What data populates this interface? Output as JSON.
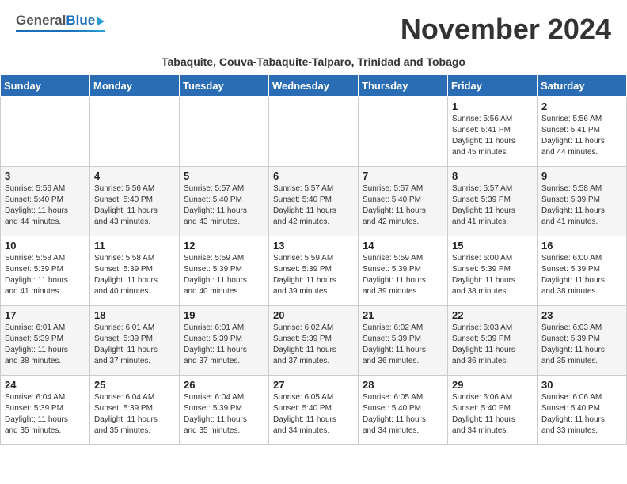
{
  "header": {
    "logo_general": "General",
    "logo_blue": "Blue",
    "month_title": "November 2024",
    "subtitle": "Tabaquite, Couva-Tabaquite-Talparo, Trinidad and Tobago"
  },
  "calendar": {
    "days_of_week": [
      "Sunday",
      "Monday",
      "Tuesday",
      "Wednesday",
      "Thursday",
      "Friday",
      "Saturday"
    ],
    "weeks": [
      [
        {
          "date": "",
          "info": ""
        },
        {
          "date": "",
          "info": ""
        },
        {
          "date": "",
          "info": ""
        },
        {
          "date": "",
          "info": ""
        },
        {
          "date": "",
          "info": ""
        },
        {
          "date": "1",
          "info": "Sunrise: 5:56 AM\nSunset: 5:41 PM\nDaylight: 11 hours\nand 45 minutes."
        },
        {
          "date": "2",
          "info": "Sunrise: 5:56 AM\nSunset: 5:41 PM\nDaylight: 11 hours\nand 44 minutes."
        }
      ],
      [
        {
          "date": "3",
          "info": "Sunrise: 5:56 AM\nSunset: 5:40 PM\nDaylight: 11 hours\nand 44 minutes."
        },
        {
          "date": "4",
          "info": "Sunrise: 5:56 AM\nSunset: 5:40 PM\nDaylight: 11 hours\nand 43 minutes."
        },
        {
          "date": "5",
          "info": "Sunrise: 5:57 AM\nSunset: 5:40 PM\nDaylight: 11 hours\nand 43 minutes."
        },
        {
          "date": "6",
          "info": "Sunrise: 5:57 AM\nSunset: 5:40 PM\nDaylight: 11 hours\nand 42 minutes."
        },
        {
          "date": "7",
          "info": "Sunrise: 5:57 AM\nSunset: 5:40 PM\nDaylight: 11 hours\nand 42 minutes."
        },
        {
          "date": "8",
          "info": "Sunrise: 5:57 AM\nSunset: 5:39 PM\nDaylight: 11 hours\nand 41 minutes."
        },
        {
          "date": "9",
          "info": "Sunrise: 5:58 AM\nSunset: 5:39 PM\nDaylight: 11 hours\nand 41 minutes."
        }
      ],
      [
        {
          "date": "10",
          "info": "Sunrise: 5:58 AM\nSunset: 5:39 PM\nDaylight: 11 hours\nand 41 minutes."
        },
        {
          "date": "11",
          "info": "Sunrise: 5:58 AM\nSunset: 5:39 PM\nDaylight: 11 hours\nand 40 minutes."
        },
        {
          "date": "12",
          "info": "Sunrise: 5:59 AM\nSunset: 5:39 PM\nDaylight: 11 hours\nand 40 minutes."
        },
        {
          "date": "13",
          "info": "Sunrise: 5:59 AM\nSunset: 5:39 PM\nDaylight: 11 hours\nand 39 minutes."
        },
        {
          "date": "14",
          "info": "Sunrise: 5:59 AM\nSunset: 5:39 PM\nDaylight: 11 hours\nand 39 minutes."
        },
        {
          "date": "15",
          "info": "Sunrise: 6:00 AM\nSunset: 5:39 PM\nDaylight: 11 hours\nand 38 minutes."
        },
        {
          "date": "16",
          "info": "Sunrise: 6:00 AM\nSunset: 5:39 PM\nDaylight: 11 hours\nand 38 minutes."
        }
      ],
      [
        {
          "date": "17",
          "info": "Sunrise: 6:01 AM\nSunset: 5:39 PM\nDaylight: 11 hours\nand 38 minutes."
        },
        {
          "date": "18",
          "info": "Sunrise: 6:01 AM\nSunset: 5:39 PM\nDaylight: 11 hours\nand 37 minutes."
        },
        {
          "date": "19",
          "info": "Sunrise: 6:01 AM\nSunset: 5:39 PM\nDaylight: 11 hours\nand 37 minutes."
        },
        {
          "date": "20",
          "info": "Sunrise: 6:02 AM\nSunset: 5:39 PM\nDaylight: 11 hours\nand 37 minutes."
        },
        {
          "date": "21",
          "info": "Sunrise: 6:02 AM\nSunset: 5:39 PM\nDaylight: 11 hours\nand 36 minutes."
        },
        {
          "date": "22",
          "info": "Sunrise: 6:03 AM\nSunset: 5:39 PM\nDaylight: 11 hours\nand 36 minutes."
        },
        {
          "date": "23",
          "info": "Sunrise: 6:03 AM\nSunset: 5:39 PM\nDaylight: 11 hours\nand 35 minutes."
        }
      ],
      [
        {
          "date": "24",
          "info": "Sunrise: 6:04 AM\nSunset: 5:39 PM\nDaylight: 11 hours\nand 35 minutes."
        },
        {
          "date": "25",
          "info": "Sunrise: 6:04 AM\nSunset: 5:39 PM\nDaylight: 11 hours\nand 35 minutes."
        },
        {
          "date": "26",
          "info": "Sunrise: 6:04 AM\nSunset: 5:39 PM\nDaylight: 11 hours\nand 35 minutes."
        },
        {
          "date": "27",
          "info": "Sunrise: 6:05 AM\nSunset: 5:40 PM\nDaylight: 11 hours\nand 34 minutes."
        },
        {
          "date": "28",
          "info": "Sunrise: 6:05 AM\nSunset: 5:40 PM\nDaylight: 11 hours\nand 34 minutes."
        },
        {
          "date": "29",
          "info": "Sunrise: 6:06 AM\nSunset: 5:40 PM\nDaylight: 11 hours\nand 34 minutes."
        },
        {
          "date": "30",
          "info": "Sunrise: 6:06 AM\nSunset: 5:40 PM\nDaylight: 11 hours\nand 33 minutes."
        }
      ]
    ]
  }
}
